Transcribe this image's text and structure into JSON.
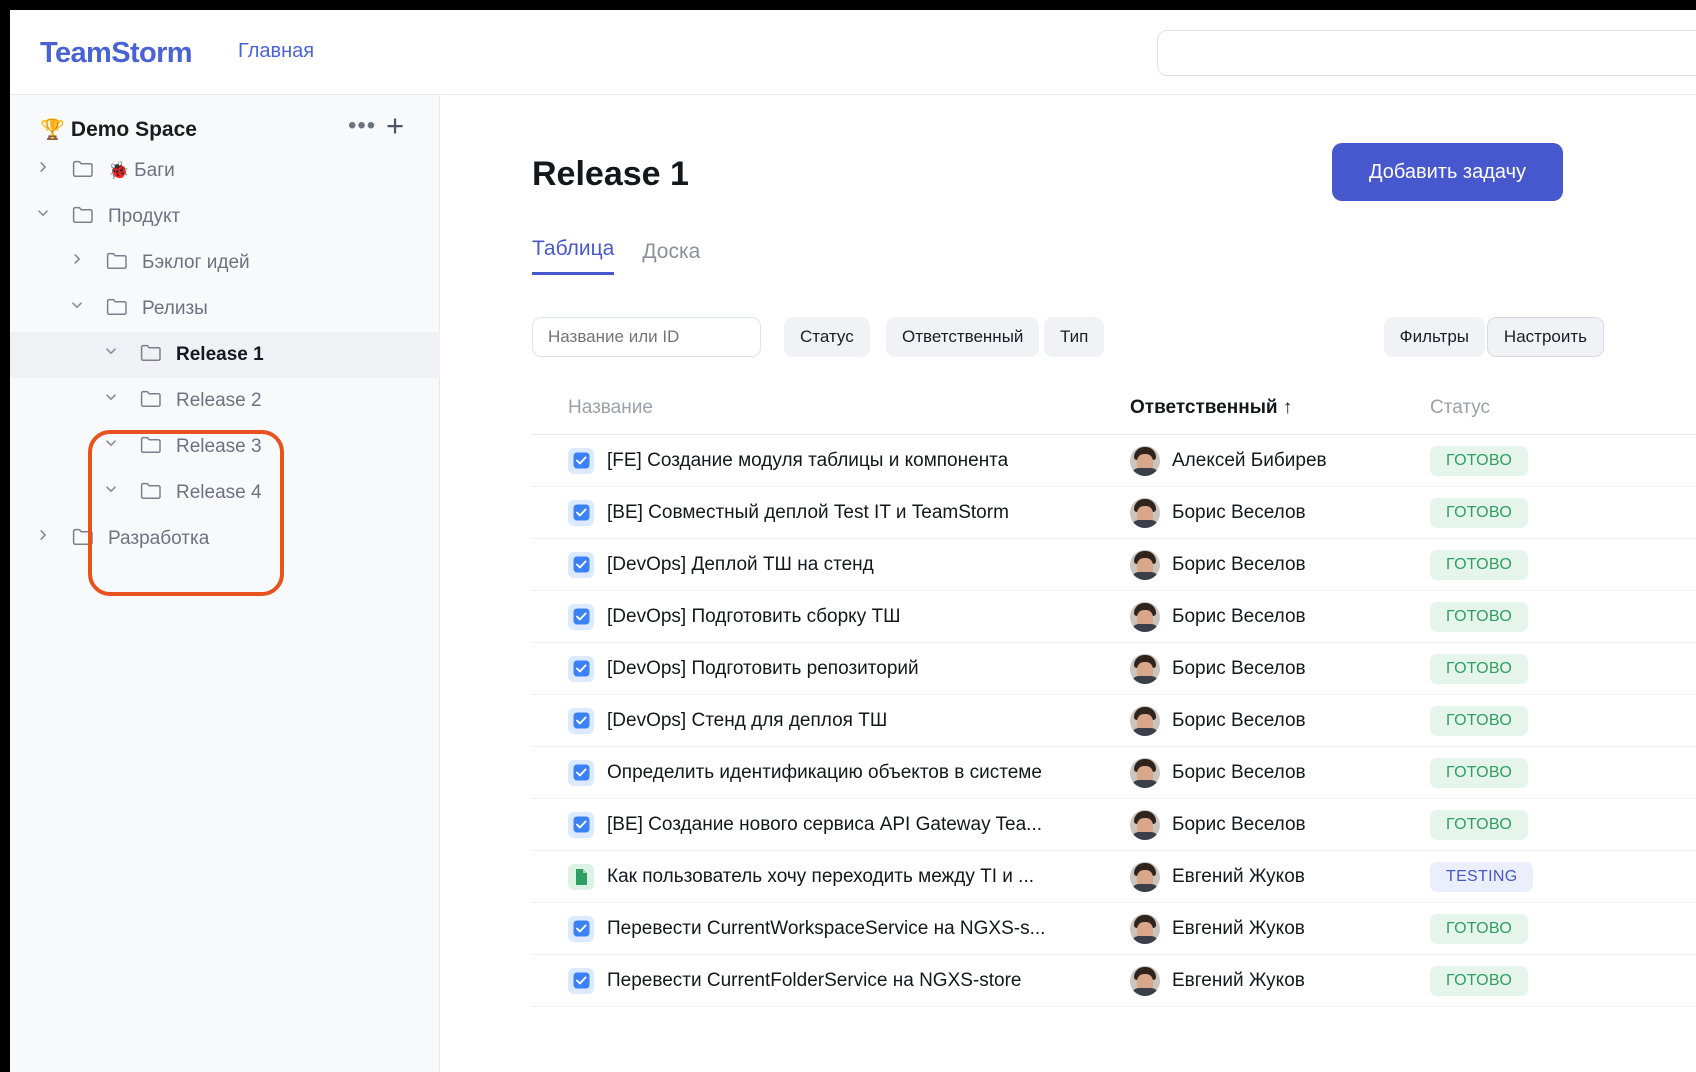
{
  "header": {
    "logo": "TeamStorm",
    "nav_home": "Главная",
    "search_value": "",
    "search_placeholder": ""
  },
  "sidebar": {
    "space_name": "Demo Space",
    "space_emoji": "🏆",
    "more_icon": "•••",
    "add_icon": "+",
    "tree": [
      {
        "label": "Баги",
        "emoji": "🐞",
        "depth": 0,
        "expanded": false,
        "active": false
      },
      {
        "label": "Продукт",
        "emoji": "",
        "depth": 0,
        "expanded": true,
        "active": false
      },
      {
        "label": "Бэклог идей",
        "emoji": "",
        "depth": 1,
        "expanded": false,
        "active": false
      },
      {
        "label": "Релизы",
        "emoji": "",
        "depth": 1,
        "expanded": true,
        "active": false
      },
      {
        "label": "Release 1",
        "emoji": "",
        "depth": 2,
        "expanded": true,
        "active": true
      },
      {
        "label": "Release 2",
        "emoji": "",
        "depth": 2,
        "expanded": true,
        "active": false
      },
      {
        "label": "Release 3",
        "emoji": "",
        "depth": 2,
        "expanded": true,
        "active": false
      },
      {
        "label": "Release 4",
        "emoji": "",
        "depth": 2,
        "expanded": true,
        "active": false
      },
      {
        "label": "Разработка",
        "emoji": "",
        "depth": 0,
        "expanded": false,
        "active": false
      }
    ],
    "annotation_color": "#e8521f"
  },
  "main": {
    "title": "Release 1",
    "add_task_label": "Добавить задачу",
    "accent_color": "#4758cf",
    "tabs": [
      {
        "label": "Таблица",
        "active": true
      },
      {
        "label": "Доска",
        "active": false
      }
    ],
    "toolbar": {
      "search_value": "",
      "search_placeholder": "Название или ID",
      "chips": [
        "Статус",
        "Ответственный",
        "Тип"
      ],
      "filters_label": "Фильтры",
      "settings_label": "Настроить"
    },
    "table": {
      "columns": {
        "name": "Название",
        "assignee": "Ответственный ↑",
        "status": "Статус"
      },
      "rows": [
        {
          "icon": "task-checkbox-icon",
          "title": "[FE] Создание модуля таблицы и компонента",
          "assignee": "Алексей Бибирев",
          "status": "ГОТОВО",
          "status_kind": "done"
        },
        {
          "icon": "task-checkbox-icon",
          "title": "[BE] Совместный деплой Test IT и TeamStorm",
          "assignee": "Борис Веселов",
          "status": "ГОТОВО",
          "status_kind": "done"
        },
        {
          "icon": "task-checkbox-icon",
          "title": "[DevOps] Деплой ТШ на стенд",
          "assignee": "Борис Веселов",
          "status": "ГОТОВО",
          "status_kind": "done"
        },
        {
          "icon": "task-checkbox-icon",
          "title": "[DevOps] Подготовить сборку ТШ",
          "assignee": "Борис Веселов",
          "status": "ГОТОВО",
          "status_kind": "done"
        },
        {
          "icon": "task-checkbox-icon",
          "title": "[DevOps] Подготовить репозиторий",
          "assignee": "Борис Веселов",
          "status": "ГОТОВО",
          "status_kind": "done"
        },
        {
          "icon": "task-checkbox-icon",
          "title": "[DevOps] Стенд для деплоя ТШ",
          "assignee": "Борис Веселов",
          "status": "ГОТОВО",
          "status_kind": "done"
        },
        {
          "icon": "task-checkbox-icon",
          "title": "Определить идентификацию объектов в системе",
          "assignee": "Борис Веселов",
          "status": "ГОТОВО",
          "status_kind": "done"
        },
        {
          "icon": "task-checkbox-icon",
          "title": "[BE] Создание нового сервиса API Gateway Tea...",
          "assignee": "Борис Веселов",
          "status": "ГОТОВО",
          "status_kind": "done"
        },
        {
          "icon": "story-document-icon",
          "title": "Как пользователь хочу переходить между TI и ...",
          "assignee": "Евгений Жуков",
          "status": "TESTING",
          "status_kind": "testing"
        },
        {
          "icon": "task-checkbox-icon",
          "title": "Перевести CurrentWorkspaceService на NGXS-s...",
          "assignee": "Евгений Жуков",
          "status": "ГОТОВО",
          "status_kind": "done"
        },
        {
          "icon": "task-checkbox-icon",
          "title": "Перевести CurrentFolderService на NGXS-store",
          "assignee": "Евгений Жуков",
          "status": "ГОТОВО",
          "status_kind": "done"
        }
      ]
    }
  }
}
